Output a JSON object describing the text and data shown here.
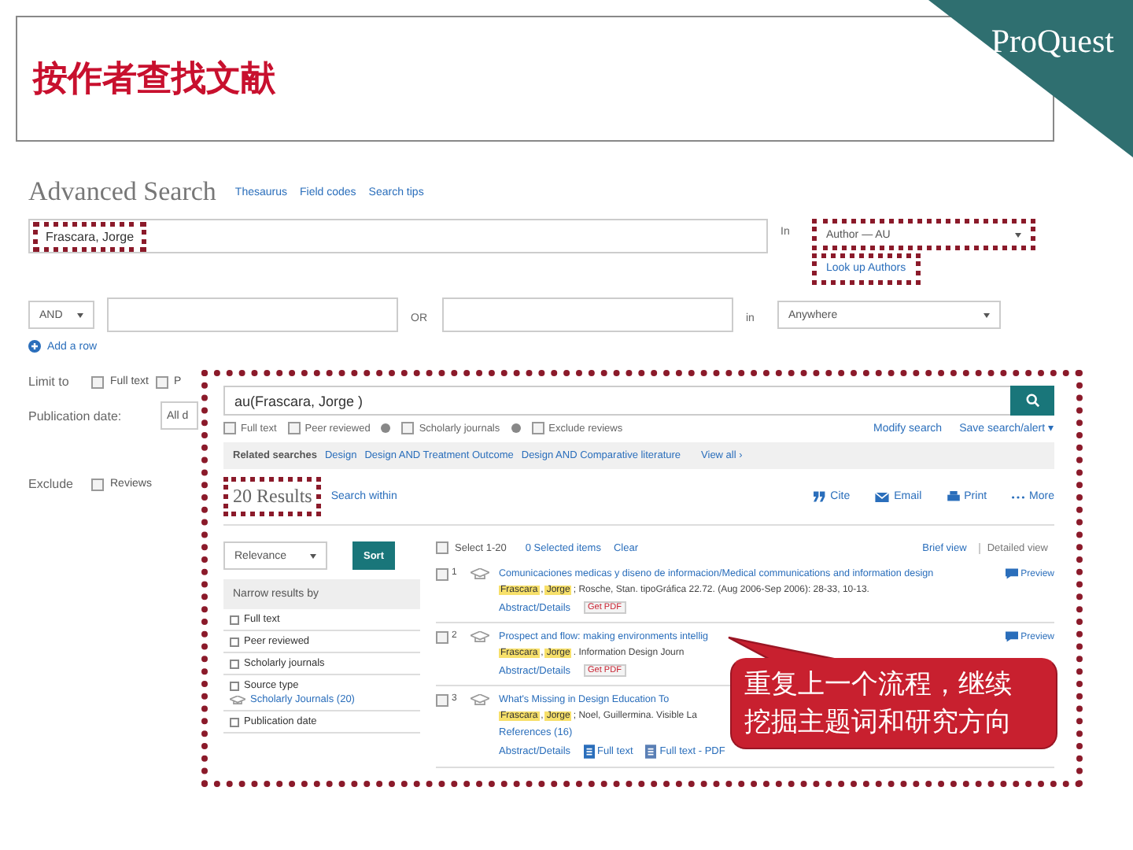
{
  "slide": {
    "title": "按作者查找文献",
    "logo": "ProQuest"
  },
  "advanced_search": {
    "heading": "Advanced Search",
    "links": [
      "Thesaurus",
      "Field codes",
      "Search tips"
    ],
    "row_1": {
      "value": "Frascara, Jorge",
      "in_label": "In",
      "field": "Author — AU",
      "highlighted": true,
      "lookup_link": "Look up Authors"
    },
    "row_2": {
      "operator": "AND",
      "or_label": "OR",
      "in_label": "in",
      "field": "Anywhere"
    },
    "add_row": "Add a row",
    "limit_to": {
      "label": "Limit to",
      "options": [
        {
          "label": "Full text",
          "checked": false
        },
        {
          "label": "P",
          "checked": false
        }
      ]
    },
    "publication_date": {
      "label": "Publication date:",
      "value": "All d"
    },
    "exclude": {
      "label": "Exclude",
      "options": [
        {
          "label": "Reviews",
          "checked": false
        }
      ]
    }
  },
  "results_panel": {
    "query": "au(Frascara, Jorge )",
    "filters": [
      {
        "label": "Full text",
        "checked": false,
        "info": false
      },
      {
        "label": "Peer reviewed",
        "checked": false,
        "info": true
      },
      {
        "label": "Scholarly journals",
        "checked": false,
        "info": true
      },
      {
        "label": "Exclude reviews",
        "checked": false,
        "info": false
      }
    ],
    "actions": [
      "Modify search",
      "Save search/alert ▾"
    ],
    "related": {
      "label": "Related searches",
      "items": [
        "Design",
        "Design AND Treatment Outcome",
        "Design AND Comparative literature"
      ],
      "view_all": "View all ›"
    },
    "count": "20 Results",
    "count_highlighted": true,
    "search_within": "Search within",
    "tools": [
      {
        "kind": "cite",
        "label": "Cite"
      },
      {
        "kind": "email",
        "label": "Email"
      },
      {
        "kind": "print",
        "label": "Print"
      },
      {
        "kind": "more",
        "label": "More"
      }
    ],
    "sort": {
      "value": "Relevance",
      "button": "Sort"
    },
    "narrow": {
      "heading": "Narrow results by",
      "facets": [
        {
          "label": "Full text"
        },
        {
          "label": "Peer reviewed"
        },
        {
          "label": "Scholarly journals"
        },
        {
          "label": "Source type",
          "children": [
            {
              "label": "Scholarly Journals (20)"
            }
          ]
        },
        {
          "label": "Publication date"
        }
      ]
    },
    "select_all": {
      "label": "Select 1-20",
      "checked": false
    },
    "selected_items": "0 Selected items",
    "clear": "Clear",
    "views": [
      {
        "label": "Brief view",
        "selected": false
      },
      {
        "label": "Detailed view",
        "selected": true
      }
    ],
    "results": [
      {
        "number": "1",
        "checked": false,
        "title": "Comunicaciones medicas y diseno de informacion/Medical communications and information design",
        "preview": "Preview",
        "byline": [
          {
            "text": "Frascara",
            "highlight": true
          },
          {
            "text": ",",
            "highlight": false
          },
          {
            "text": "Jorge",
            "highlight": true
          },
          {
            "text": "; Rosche, Stan. tipoGráfica 22.72. (Aug 2006-Sep 2006): 28-33, 10-13.",
            "highlight": false
          }
        ],
        "links": [
          {
            "kind": "text",
            "label": "Abstract/Details"
          },
          {
            "kind": "badge",
            "label": "Get PDF"
          }
        ]
      },
      {
        "number": "2",
        "checked": false,
        "title": "Prospect and flow: making environments intellig",
        "preview": "Preview",
        "byline": [
          {
            "text": "Frascara",
            "highlight": true
          },
          {
            "text": ",",
            "highlight": false
          },
          {
            "text": "Jorge",
            "highlight": true
          },
          {
            "text": ". Information Design Journ",
            "highlight": false
          }
        ],
        "links": [
          {
            "kind": "text",
            "label": "Abstract/Details"
          },
          {
            "kind": "badge",
            "label": "Get PDF"
          }
        ]
      },
      {
        "number": "3",
        "checked": false,
        "title": "What's Missing in Design Education To",
        "byline": [
          {
            "text": "Frascara",
            "highlight": true
          },
          {
            "text": ",",
            "highlight": false
          },
          {
            "text": "Jorge",
            "highlight": true
          },
          {
            "text": "; Noel, Guillermina. Visible La",
            "highlight": false
          }
        ],
        "references": "References (16)",
        "links": [
          {
            "kind": "text",
            "label": "Abstract/Details"
          },
          {
            "kind": "fulltext",
            "label": "Full text"
          },
          {
            "kind": "pdf",
            "label": "Full text - PDF"
          }
        ]
      }
    ]
  },
  "callout": {
    "lines": [
      "重复上一个流程，继续",
      "挖掘主题词和研究方向"
    ]
  }
}
